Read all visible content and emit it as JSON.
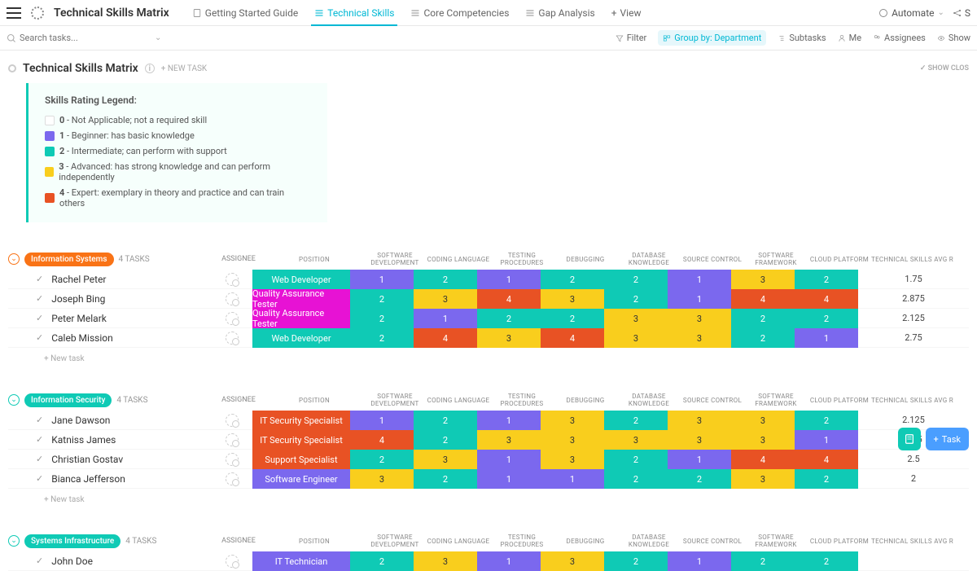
{
  "header": {
    "title": "Technical Skills Matrix",
    "tabs": [
      {
        "label": "Getting Started Guide",
        "active": false
      },
      {
        "label": "Technical Skills",
        "active": true
      },
      {
        "label": "Core Competencies",
        "active": false
      },
      {
        "label": "Gap Analysis",
        "active": false
      }
    ],
    "viewlabel": "View",
    "automate": "Automate",
    "share": "S"
  },
  "search": {
    "placeholder": "Search tasks..."
  },
  "toolbar": {
    "filter": "Filter",
    "groupby": "Group by: Department",
    "subtasks": "Subtasks",
    "me": "Me",
    "assignees": "Assignees",
    "show": "Show"
  },
  "list": {
    "title": "Technical Skills Matrix",
    "newtask": "+ NEW TASK",
    "showclosed": "SHOW CLOS"
  },
  "legend": {
    "title": "Skills Rating Legend:",
    "items": [
      {
        "color": "#ffffff",
        "num": "0",
        "text": " - Not Applicable; not a required skill"
      },
      {
        "color": "#7b68ee",
        "num": "1",
        "text": " - Beginner:  has basic knowledge"
      },
      {
        "color": "#0fcab5",
        "num": "2",
        "text": " - Intermediate; can perform with support"
      },
      {
        "color": "#f9ce1d",
        "num": "3",
        "text": " - Advanced: has strong knowledge and can perform independently"
      },
      {
        "color": "#e85224",
        "num": "4",
        "text": " - Expert: exemplary in theory and practice and can train others"
      }
    ]
  },
  "columns": {
    "assignee": "ASSIGNEE",
    "position": "POSITION",
    "sd": "SOFTWARE DEVELOPMENT",
    "cl": "CODING LANGUAGE",
    "tp": "TESTING PROCEDURES",
    "db": "DEBUGGING",
    "dk": "DATABASE KNOWLEDGE",
    "sc": "SOURCE CONTROL",
    "sf": "SOFTWARE FRAMEWORK",
    "cp": "CLOUD PLATFORM",
    "avg": "TECHNICAL SKILLS AVG R"
  },
  "newtaskrow": "+ New task",
  "sections": [
    {
      "name": "Information Systems",
      "color": "#f97316",
      "taskcount": "4 TASKS",
      "rows": [
        {
          "name": "Rachel Peter",
          "position": "Web Developer",
          "posClass": "position-teal",
          "scores": [
            1,
            2,
            1,
            2,
            2,
            1,
            3,
            2
          ],
          "avg": "1.75"
        },
        {
          "name": "Joseph Bing",
          "position": "Quality Assurance Tester",
          "posClass": "position-magenta",
          "scores": [
            2,
            3,
            4,
            3,
            2,
            1,
            4,
            4
          ],
          "avg": "2.875"
        },
        {
          "name": "Peter Melark",
          "position": "Quality Assurance Tester",
          "posClass": "position-magenta",
          "scores": [
            2,
            1,
            2,
            2,
            3,
            3,
            2,
            2
          ],
          "avg": "2.125"
        },
        {
          "name": "Caleb Mission",
          "position": "Web Developer",
          "posClass": "position-teal",
          "scores": [
            2,
            4,
            3,
            4,
            3,
            3,
            2,
            1
          ],
          "avg": "2.75"
        }
      ]
    },
    {
      "name": "Information Security",
      "color": "#0fcab5",
      "taskcount": "4 TASKS",
      "rows": [
        {
          "name": "Jane Dawson",
          "position": "IT Security Specialist",
          "posClass": "position-orange",
          "scores": [
            1,
            2,
            1,
            3,
            2,
            3,
            3,
            2
          ],
          "avg": "2.125"
        },
        {
          "name": "Katniss James",
          "position": "IT Security Specialist",
          "posClass": "position-orange",
          "scores": [
            4,
            2,
            3,
            3,
            3,
            3,
            3,
            1
          ],
          "avg": "2.75"
        },
        {
          "name": "Christian Gostav",
          "position": "Support Specialist",
          "posClass": "position-orange",
          "scores": [
            2,
            3,
            1,
            3,
            2,
            1,
            4,
            4
          ],
          "avg": "2.5"
        },
        {
          "name": "Bianca Jefferson",
          "position": "Software Engineer",
          "posClass": "position-purple",
          "scores": [
            3,
            2,
            1,
            1,
            2,
            2,
            3,
            2
          ],
          "avg": "2"
        }
      ]
    },
    {
      "name": "Systems Infrastructure",
      "color": "#0fcab5",
      "taskcount": "4 TASKS",
      "rows": [
        {
          "name": "John Doe",
          "position": "IT Technician",
          "posClass": "position-purple",
          "scores": [
            2,
            3,
            1,
            3,
            2,
            1,
            2,
            2
          ],
          "avg": ""
        }
      ]
    }
  ],
  "fab": {
    "q": "?",
    "task": "Task"
  },
  "check": "✓"
}
